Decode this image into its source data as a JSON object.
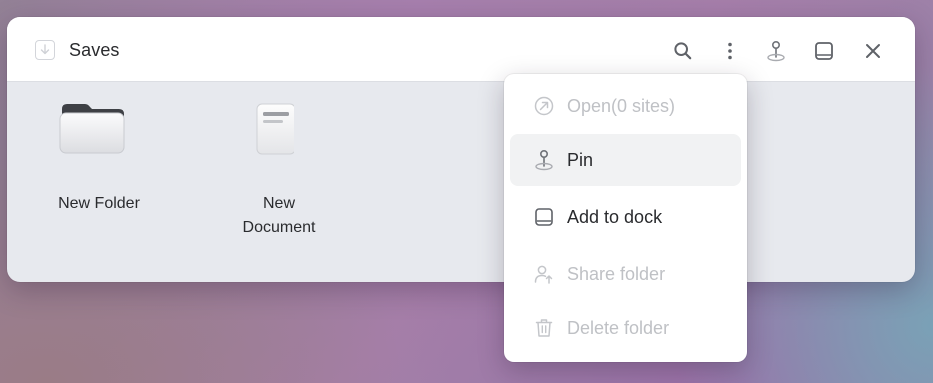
{
  "window": {
    "title": "Saves"
  },
  "toolbar": {
    "icons": [
      "search-icon",
      "more-vertical-icon",
      "pin-icon",
      "dock-icon",
      "close-icon"
    ]
  },
  "items": [
    {
      "label": "New Folder",
      "icon": "folder-icon"
    },
    {
      "label_line1": "New",
      "label_line2": "Document",
      "icon": "document-icon"
    }
  ],
  "menu": {
    "items": [
      {
        "label": "Open(0 sites)",
        "icon": "open-external-icon",
        "enabled": false
      },
      {
        "label": "Pin",
        "icon": "pin-icon",
        "enabled": true,
        "highlighted": true
      },
      {
        "label": "Add to dock",
        "icon": "dock-icon",
        "enabled": true
      },
      {
        "label": "Share folder",
        "icon": "share-user-icon",
        "enabled": false
      },
      {
        "label": "Delete folder",
        "icon": "trash-icon",
        "enabled": false
      }
    ]
  },
  "colors": {
    "text": "#2a2b2e",
    "disabled_text": "#bfc1c5",
    "icon": "#6f7278",
    "content_bg": "#e7e9ee",
    "hover_bg": "#f1f2f3"
  }
}
